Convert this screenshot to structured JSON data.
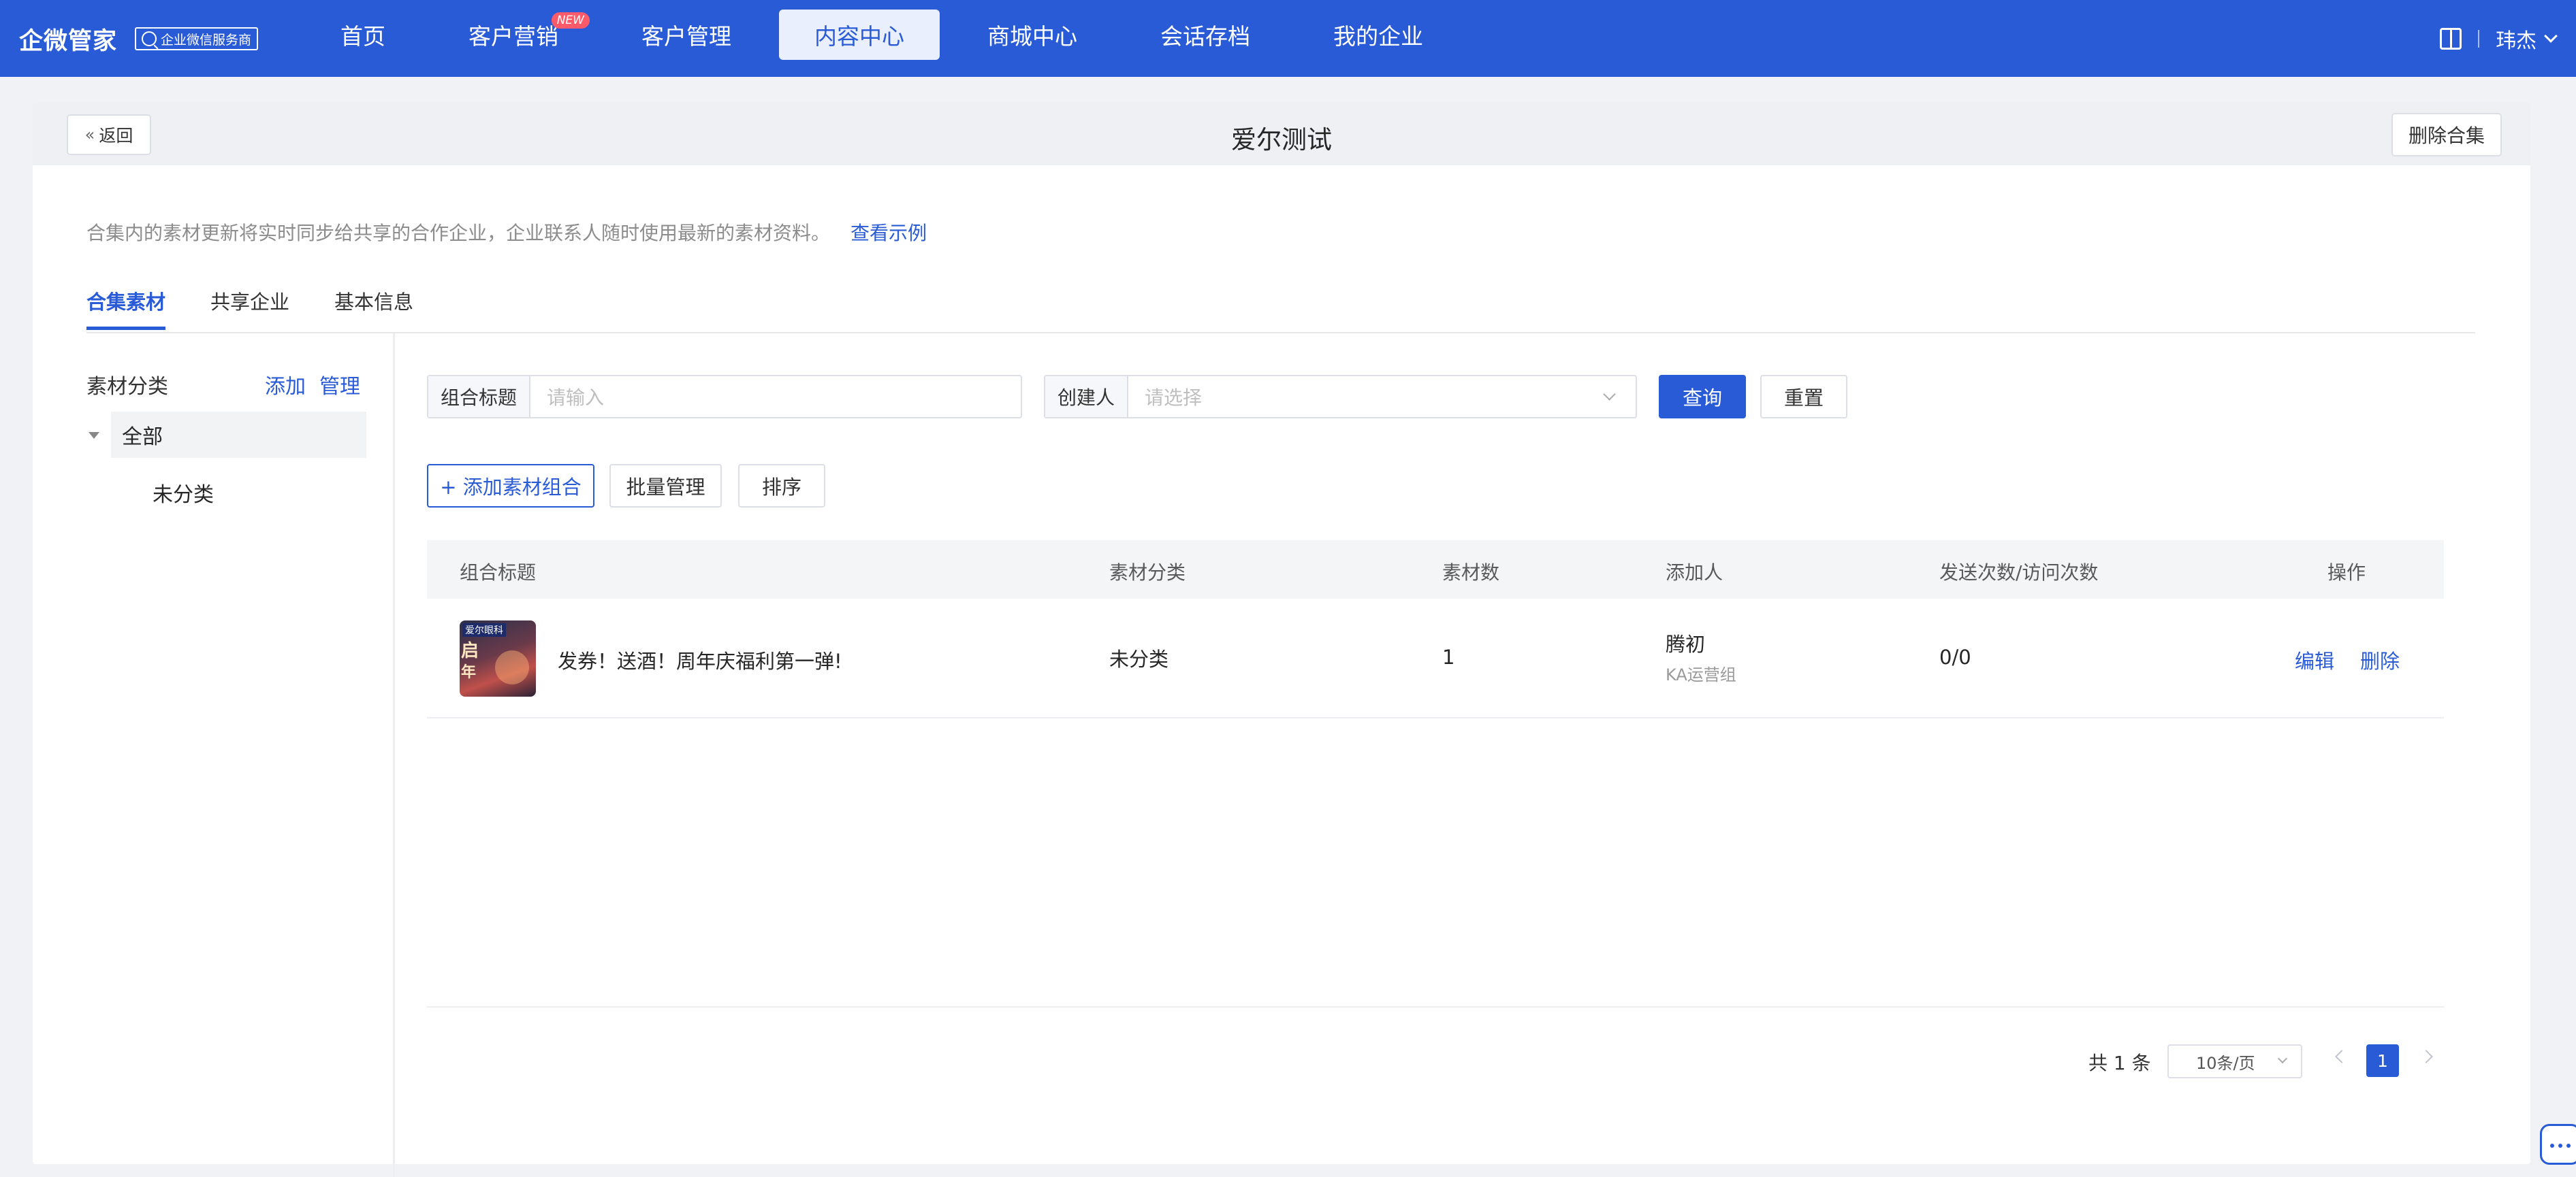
{
  "topbar": {
    "brand_name": "企微管家",
    "brand_badge": "企业微信服务商",
    "nav": [
      {
        "label": "首页",
        "badge": null,
        "active": false
      },
      {
        "label": "客户营销",
        "badge": "NEW",
        "active": false
      },
      {
        "label": "客户管理",
        "badge": null,
        "active": false
      },
      {
        "label": "内容中心",
        "badge": null,
        "active": true
      },
      {
        "label": "商城中心",
        "badge": null,
        "active": false
      },
      {
        "label": "会话存档",
        "badge": null,
        "active": false
      },
      {
        "label": "我的企业",
        "badge": null,
        "active": false
      }
    ],
    "user_name": "玮杰",
    "icons": {
      "docs": "book-icon",
      "user_menu": "chevron-down-icon"
    }
  },
  "header": {
    "back_label": "返回",
    "title": "爱尔测试",
    "delete_label": "删除合集"
  },
  "notice": {
    "text": "合集内的素材更新将实时同步给共享的合作企业，企业联系人随时使用最新的素材资料。",
    "link": "查看示例"
  },
  "tabs": [
    {
      "label": "合集素材",
      "active": true
    },
    {
      "label": "共享企业",
      "active": false
    },
    {
      "label": "基本信息",
      "active": false
    }
  ],
  "sidebar": {
    "title": "素材分类",
    "add_label": "添加",
    "manage_label": "管理",
    "tree": {
      "root": "全部",
      "children": [
        "未分类"
      ]
    }
  },
  "filters": {
    "title_label": "组合标题",
    "title_placeholder": "请输入",
    "creator_label": "创建人",
    "creator_placeholder": "请选择",
    "query_label": "查询",
    "reset_label": "重置"
  },
  "actions": {
    "add_label": "+ 添加素材组合",
    "batch_label": "批量管理",
    "sort_label": "排序"
  },
  "table": {
    "columns": [
      "组合标题",
      "素材分类",
      "素材数",
      "添加人",
      "发送次数/访问次数",
      "操作"
    ],
    "rows": [
      {
        "title": "发券！送酒！周年庆福利第一弹!",
        "category": "未分类",
        "count": "1",
        "adder": "腾初",
        "adder_group": "KA运营组",
        "send_visit": "0/0",
        "edit_label": "编辑",
        "delete_label": "删除",
        "thumb_text": [
          "爱尔眼科",
          "启",
          "年"
        ]
      }
    ]
  },
  "pagination": {
    "total": "共 1 条",
    "page_size": "10条/页",
    "current": "1"
  },
  "colors": {
    "primary": "#2a5bd7",
    "nav_active_bg": "#e9effc",
    "badge": "#ff5a6a"
  }
}
